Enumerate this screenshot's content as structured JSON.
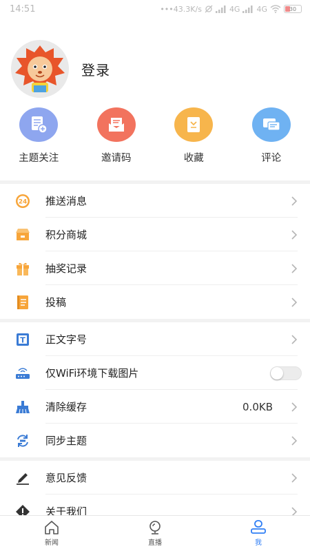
{
  "status_bar": {
    "time": "14:51",
    "network_speed": "43.3K/s",
    "signal1": "4G",
    "signal2": "4G",
    "battery": "30"
  },
  "profile": {
    "login_label": "登录"
  },
  "quick_actions": [
    {
      "label": "主题关注",
      "icon": "subscribe-icon",
      "color": "#8ea6ef"
    },
    {
      "label": "邀请码",
      "icon": "invite-envelope-icon",
      "color": "#f2735e"
    },
    {
      "label": "收藏",
      "icon": "bookmark-icon",
      "color": "#f7b54c"
    },
    {
      "label": "评论",
      "icon": "comment-icon",
      "color": "#6fb2f2"
    }
  ],
  "menu_group1": [
    {
      "label": "推送消息",
      "icon": "push-24-icon"
    },
    {
      "label": "积分商城",
      "icon": "shop-icon"
    },
    {
      "label": "抽奖记录",
      "icon": "gift-icon"
    },
    {
      "label": "投稿",
      "icon": "contribute-icon"
    }
  ],
  "menu_group2": [
    {
      "label": "正文字号",
      "icon": "font-size-icon"
    },
    {
      "label": "仅WiFi环境下载图片",
      "icon": "wifi-router-icon"
    },
    {
      "label": "清除缓存",
      "icon": "broom-icon",
      "value": "0.0KB"
    },
    {
      "label": "同步主题",
      "icon": "sync-icon"
    }
  ],
  "menu_group3": [
    {
      "label": "意见反馈",
      "icon": "pen-icon"
    },
    {
      "label": "关于我们",
      "icon": "info-icon"
    }
  ],
  "tabbar": [
    {
      "label": "新闻",
      "icon": "home-icon",
      "active": false
    },
    {
      "label": "直播",
      "icon": "live-icon",
      "active": false
    },
    {
      "label": "我",
      "icon": "profile-icon",
      "active": true
    }
  ],
  "colors": {
    "accent": "#2f7ef5",
    "orange_icon": "#f7a53a",
    "blue_icon": "#3a7bd5"
  }
}
